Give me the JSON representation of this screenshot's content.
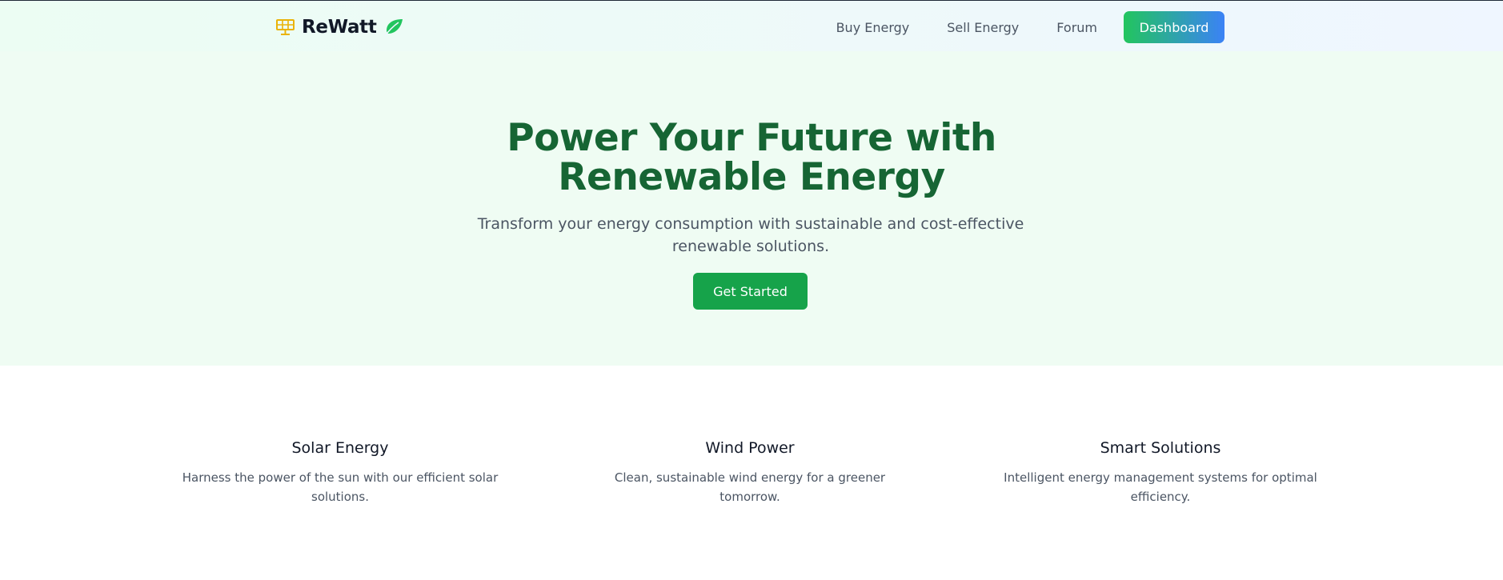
{
  "brand": {
    "name": "ReWatt",
    "icons": [
      "solar-panel-icon",
      "leaf-icon"
    ]
  },
  "nav": {
    "links": [
      "Buy Energy",
      "Sell Energy",
      "Forum"
    ],
    "dashboard_label": "Dashboard"
  },
  "hero": {
    "title_line1": "Power Your Future with",
    "title_line2": "Renewable Energy",
    "subtitle": "Transform your energy consumption with sustainable and cost-effective renewable solutions.",
    "cta_label": "Get Started"
  },
  "features": [
    {
      "title": "Solar Energy",
      "description": "Harness the power of the sun with our efficient solar solutions."
    },
    {
      "title": "Wind Power",
      "description": "Clean, sustainable wind energy for a greener tomorrow."
    },
    {
      "title": "Smart Solutions",
      "description": "Intelligent energy management systems for optimal efficiency."
    }
  ],
  "colors": {
    "brand_green": "#166534",
    "cta_green": "#16a34a",
    "solar_yellow": "#eab308",
    "leaf_green": "#22c55e",
    "gradient_start": "#22c55e",
    "gradient_end": "#3b82f6",
    "hero_bg": "#effcf3"
  }
}
